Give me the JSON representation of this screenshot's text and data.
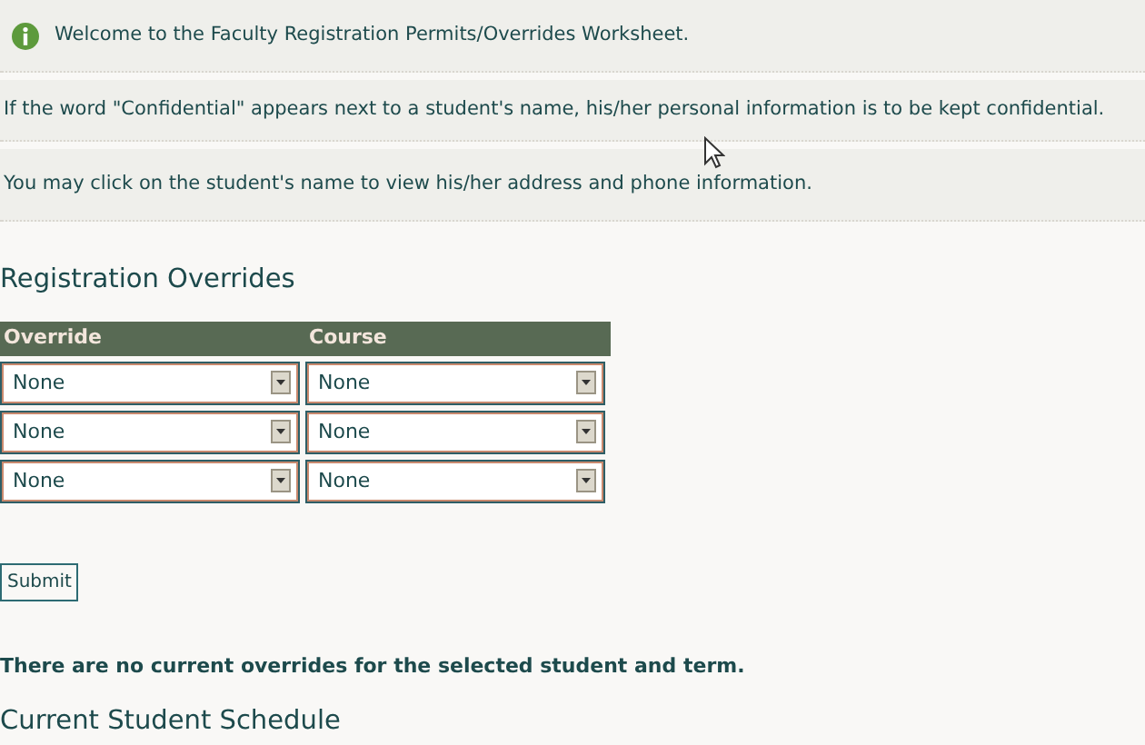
{
  "info_messages": [
    {
      "kind": "info",
      "text": "Welcome to the Faculty Registration Permits/Overrides Worksheet."
    },
    {
      "kind": "plain",
      "text": "If the word \"Confidential\" appears next to a student's name, his/her personal information is to be kept confidential."
    },
    {
      "kind": "plain",
      "text": "You may click on the student's name to view his/her address and phone information."
    }
  ],
  "overrides": {
    "heading": "Registration Overrides",
    "columns": [
      "Override",
      "Course"
    ],
    "rows": [
      [
        "None",
        "None"
      ],
      [
        "None",
        "None"
      ],
      [
        "None",
        "None"
      ]
    ]
  },
  "submit_button": "Submit",
  "notice": "There are no current overrides for the selected student and term.",
  "schedule_heading": "Current Student Schedule"
}
